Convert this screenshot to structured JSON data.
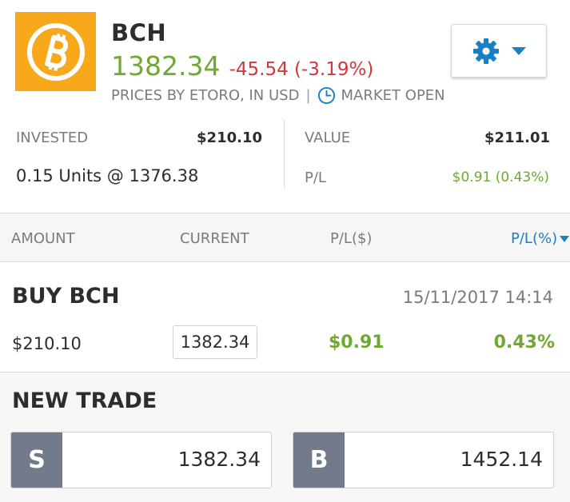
{
  "instrument": {
    "ticker": "BCH",
    "price": "1382.34",
    "change": "-45.54 (-3.19%)",
    "source": "PRICES BY ETORO, IN USD",
    "separator": "|",
    "market_status": "MARKET OPEN",
    "logo_icon": "bitcoin-icon"
  },
  "colors": {
    "positive": "#6fa832",
    "negative": "#d4363b",
    "accent": "#1a7fc3",
    "logo_bg": "#f7a81b",
    "button_grey": "#737a8c"
  },
  "summary": {
    "invested_label": "INVESTED",
    "invested_value": "$210.10",
    "units": "0.15 Units @ 1376.38",
    "value_label": "VALUE",
    "value_value": "$211.01",
    "pl_label": "P/L",
    "pl_value": "$0.91 (0.43%)"
  },
  "columns": {
    "amount": "AMOUNT",
    "current": "CURRENT",
    "pl": "P/L($)",
    "plpct": "P/L(%)"
  },
  "trade": {
    "title": "BUY BCH",
    "date": "15/11/2017 14:14",
    "amount": "$210.10",
    "current": "1382.34",
    "pl": "$0.91",
    "plpct": "0.43%"
  },
  "new_trade": {
    "title": "NEW TRADE",
    "sell_letter": "S",
    "sell_rate": "1382.34",
    "buy_letter": "B",
    "buy_rate": "1452.14"
  }
}
